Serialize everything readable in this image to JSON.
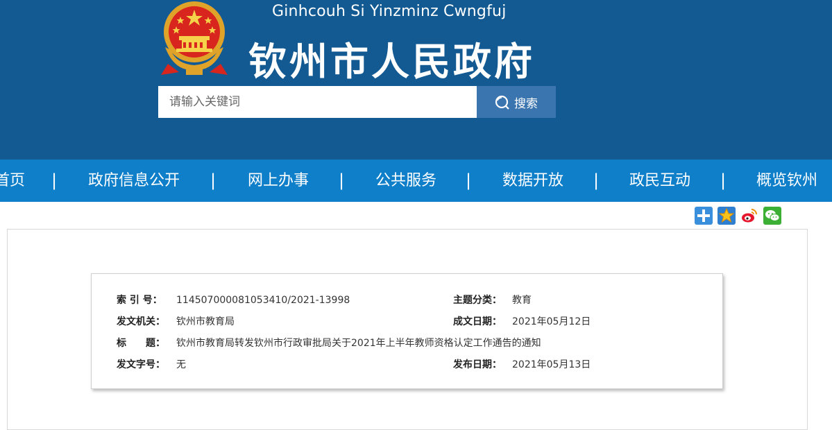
{
  "header": {
    "subtitle": "Ginhcouh Si Yinzminz Cwngfuj",
    "title": "钦州市人民政府"
  },
  "search": {
    "placeholder": "请输入关键词",
    "button_label": "搜索"
  },
  "nav": {
    "items": [
      {
        "label": "首页"
      },
      {
        "label": "政府信息公开"
      },
      {
        "label": "网上办事"
      },
      {
        "label": "公共服务"
      },
      {
        "label": "数据开放"
      },
      {
        "label": "政民互动"
      },
      {
        "label": "概览钦州"
      }
    ],
    "separator": "|"
  },
  "share": {
    "icons": [
      "plus-share-icon",
      "qzone-star-icon",
      "weibo-icon",
      "wechat-icon"
    ]
  },
  "meta": {
    "index_label": "索 引 号：",
    "index_value": "114507000081053410/2021-13998",
    "topic_label": "主题分类：",
    "topic_value": "教育",
    "issuer_label": "发文机关：",
    "issuer_value": "钦州市教育局",
    "created_label": "成文日期：",
    "created_value": "2021年05月12日",
    "title_label": "标　　题：",
    "title_value": "钦州市教育局转发钦州市行政审批局关于2021年上半年教师资格认定工作通告的通知",
    "doc_no_label": "发文字号：",
    "doc_no_value": "无",
    "published_label": "发布日期：",
    "published_value": "2021年05月13日"
  },
  "colors": {
    "header_bg": "#135a93",
    "nav_bg": "#0f7fca",
    "search_button_bg": "#3b75b0"
  }
}
